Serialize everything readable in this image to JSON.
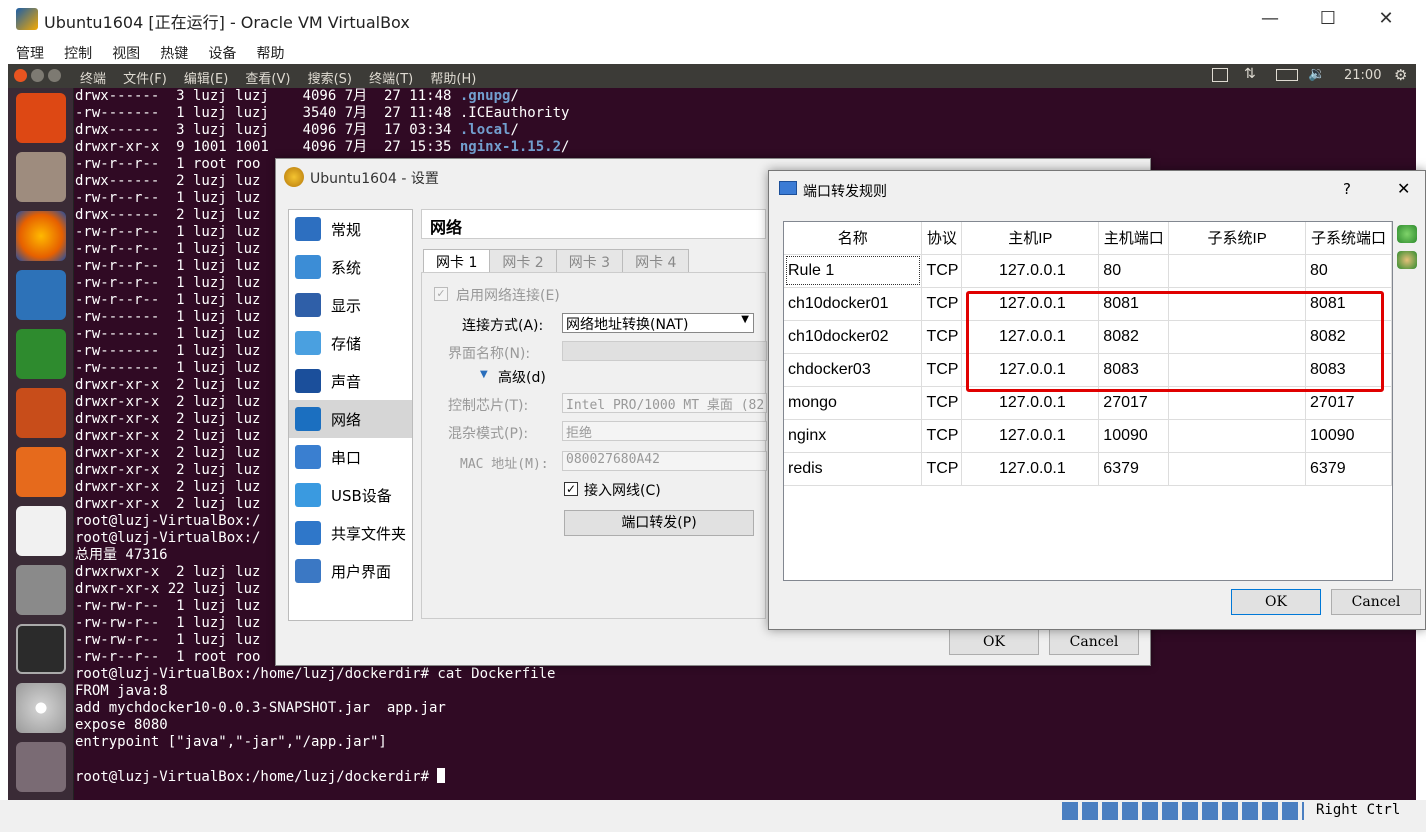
{
  "window": {
    "title": "Ubuntu1604 [正在运行] - Oracle VM VirtualBox",
    "minimize": "—",
    "maximize": "☐",
    "close": "✕"
  },
  "vb_menu": [
    "管理",
    "控制",
    "视图",
    "热键",
    "设备",
    "帮助"
  ],
  "ubuntu": {
    "menu": [
      "终端",
      "文件(F)",
      "编辑(E)",
      "查看(V)",
      "搜索(S)",
      "终端(T)",
      "帮助(H)"
    ],
    "clock": "21:00"
  },
  "terminal": {
    "lines": [
      [
        "drwx------  3 luzj luzj    4096 7月  27 11:48 ",
        ".gnupg",
        "/"
      ],
      [
        "-rw-------  1 luzj luzj    3540 7月  27 11:48 .ICEauthority",
        "",
        ""
      ],
      [
        "drwx------  3 luzj luzj    4096 7月  17 03:34 ",
        ".local",
        "/"
      ],
      [
        "drwxr-xr-x  9 1001 1001    4096 7月  27 15:35 ",
        "nginx-1.15.2",
        "/"
      ],
      [
        "-rw-r--r--  1 root roo",
        "",
        ""
      ],
      [
        "drwx------  2 luzj luz",
        "",
        ""
      ],
      [
        "-rw-r--r--  1 luzj luz",
        "",
        ""
      ],
      [
        "drwx------  2 luzj luz",
        "",
        ""
      ],
      [
        "-rw-r--r--  1 luzj luz",
        "",
        ""
      ],
      [
        "-rw-r--r--  1 luzj luz",
        "",
        ""
      ],
      [
        "-rw-r--r--  1 luzj luz",
        "",
        ""
      ],
      [
        "-rw-r--r--  1 luzj luz",
        "",
        ""
      ],
      [
        "-rw-r--r--  1 luzj luz",
        "",
        ""
      ],
      [
        "-rw-------  1 luzj luz",
        "",
        ""
      ],
      [
        "-rw-------  1 luzj luz",
        "",
        ""
      ],
      [
        "-rw-------  1 luzj luz",
        "",
        ""
      ],
      [
        "-rw-------  1 luzj luz",
        "",
        ""
      ],
      [
        "drwxr-xr-x  2 luzj luz",
        "",
        ""
      ],
      [
        "drwxr-xr-x  2 luzj luz",
        "",
        ""
      ],
      [
        "drwxr-xr-x  2 luzj luz",
        "",
        ""
      ],
      [
        "drwxr-xr-x  2 luzj luz",
        "",
        ""
      ],
      [
        "drwxr-xr-x  2 luzj luz",
        "",
        ""
      ],
      [
        "drwxr-xr-x  2 luzj luz",
        "",
        ""
      ],
      [
        "drwxr-xr-x  2 luzj luz",
        "",
        ""
      ],
      [
        "drwxr-xr-x  2 luzj luz",
        "",
        ""
      ],
      [
        "root@luzj-VirtualBox:/",
        "",
        ""
      ],
      [
        "root@luzj-VirtualBox:/",
        "",
        ""
      ],
      [
        "总用量 47316",
        "",
        ""
      ],
      [
        "drwxrwxr-x  2 luzj luz",
        "",
        ""
      ],
      [
        "drwxr-xr-x 22 luzj luz",
        "",
        ""
      ],
      [
        "-rw-rw-r--  1 luzj luz",
        "",
        ""
      ],
      [
        "-rw-rw-r--  1 luzj luz",
        "",
        ""
      ],
      [
        "-rw-rw-r--  1 luzj luz",
        "",
        ""
      ],
      [
        "-rw-r--r--  1 root roo",
        "",
        ""
      ],
      [
        "root@luzj-VirtualBox:/home/luzj/dockerdir# cat Dockerfile",
        "",
        ""
      ],
      [
        "FROM java:8",
        "",
        ""
      ],
      [
        "add mychdocker10-0.0.3-SNAPSHOT.jar  app.jar",
        "",
        ""
      ],
      [
        "expose 8080",
        "",
        ""
      ],
      [
        "entrypoint [\"java\",\"-jar\",\"/app.jar\"]",
        "",
        ""
      ],
      [
        "",
        "",
        ""
      ],
      [
        "root@luzj-VirtualBox:/home/luzj/dockerdir# ",
        "",
        ""
      ]
    ]
  },
  "settings": {
    "title": "Ubuntu1604 - 设置",
    "nav": [
      "常规",
      "系统",
      "显示",
      "存储",
      "声音",
      "网络",
      "串口",
      "USB设备",
      "共享文件夹",
      "用户界面"
    ],
    "nav_selected_index": 5,
    "section_title": "网络",
    "tabs": [
      "网卡 1",
      "网卡 2",
      "网卡 3",
      "网卡 4"
    ],
    "enable_label": "启用网络连接(E)",
    "attach_label": "连接方式(A):",
    "attach_value": "网络地址转换(NAT)",
    "name_label": "界面名称(N):",
    "advanced_label": "高级(d)",
    "adapter_label": "控制芯片(T):",
    "adapter_value": "Intel PRO/1000 MT 桌面 (82",
    "promisc_label": "混杂模式(P):",
    "promisc_value": "拒绝",
    "mac_label": "MAC 地址(M):",
    "mac_value": "080027680A42",
    "cable_label": "接入网线(C)",
    "port_forward_button": "端口转发(P)",
    "ok": "OK",
    "cancel": "Cancel"
  },
  "port_forward": {
    "title": "端口转发规则",
    "help": "?",
    "close": "✕",
    "columns": [
      "名称",
      "协议",
      "主机IP",
      "主机端口",
      "子系统IP",
      "子系统端口"
    ],
    "rows": [
      [
        "Rule 1",
        "TCP",
        "127.0.0.1",
        "80",
        "",
        "80"
      ],
      [
        "ch10docker01",
        "TCP",
        "127.0.0.1",
        "8081",
        "",
        "8081"
      ],
      [
        "ch10docker02",
        "TCP",
        "127.0.0.1",
        "8082",
        "",
        "8082"
      ],
      [
        "chdocker03",
        "TCP",
        "127.0.0.1",
        "8083",
        "",
        "8083"
      ],
      [
        "mongo",
        "TCP",
        "127.0.0.1",
        "27017",
        "",
        "27017"
      ],
      [
        "nginx",
        "TCP",
        "127.0.0.1",
        "10090",
        "",
        "10090"
      ],
      [
        "redis",
        "TCP",
        "127.0.0.1",
        "6379",
        "",
        "6379"
      ]
    ],
    "ok": "OK",
    "cancel": "Cancel",
    "highlight_color": "#e00000"
  },
  "statusbar": {
    "host_key": "Right Ctrl"
  },
  "colors": {
    "terminal_bg": "#300a24",
    "dir_blue": "#729fcf"
  }
}
